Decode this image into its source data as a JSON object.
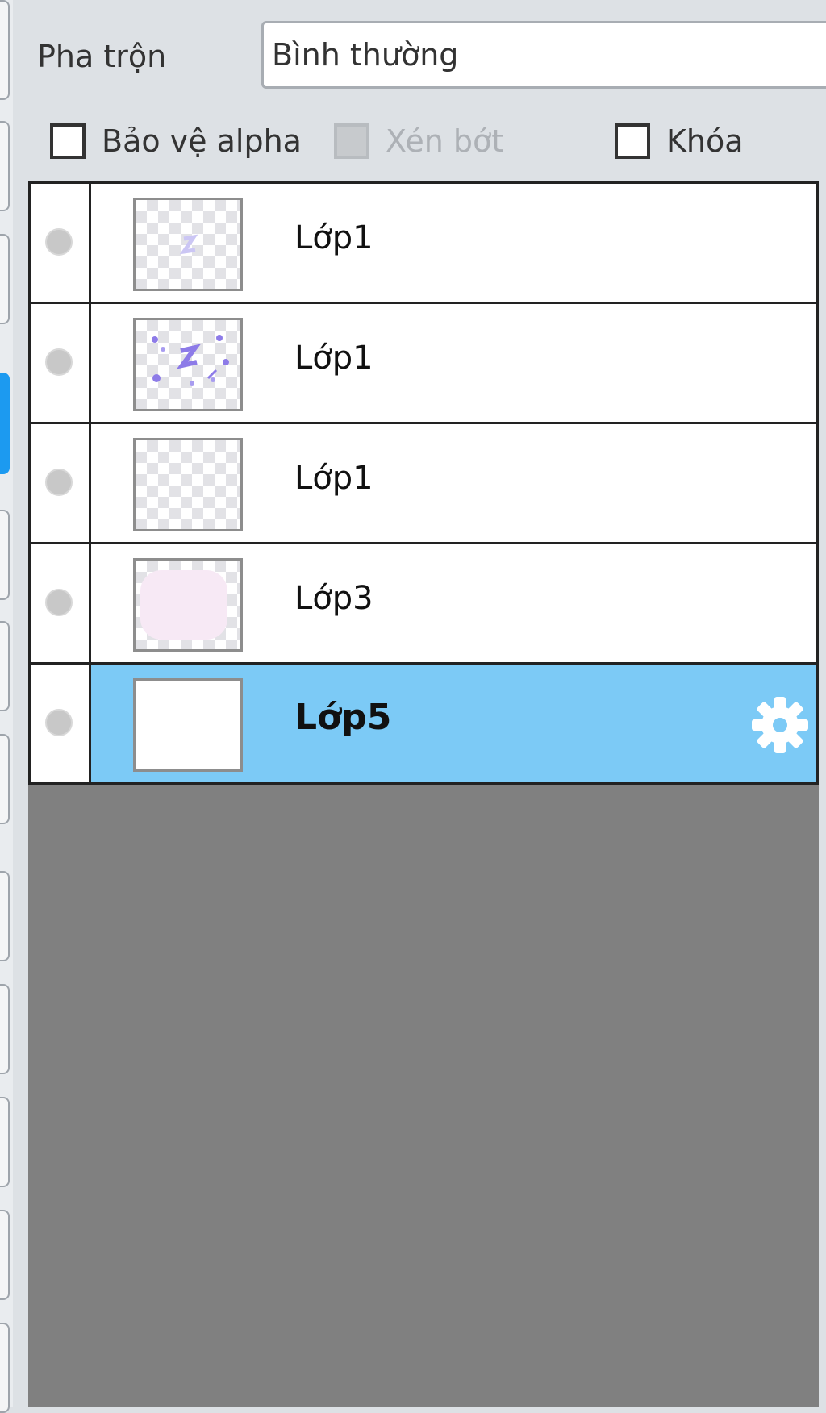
{
  "blend": {
    "label": "Pha trộn",
    "value": "Bình thường"
  },
  "options": [
    {
      "label": "Bảo vệ alpha",
      "checked": false,
      "disabled": false
    },
    {
      "label": "Xén bớt",
      "checked": false,
      "disabled": true
    },
    {
      "label": "Khóa",
      "checked": false,
      "disabled": false
    }
  ],
  "layers": [
    {
      "name": "Lớp1",
      "thumbnail": "transparent with faint purple mark",
      "selected": false
    },
    {
      "name": "Lớp1",
      "thumbnail": "transparent with purple sparkles",
      "selected": false
    },
    {
      "name": "Lớp1",
      "thumbnail": "transparent",
      "selected": false
    },
    {
      "name": "Lớp3",
      "thumbnail": "transparent with pink fill",
      "selected": false
    },
    {
      "name": "Lớp5",
      "thumbnail": "white",
      "selected": true,
      "icon": "gear-icon"
    }
  ],
  "colors": {
    "panel_background": "#dde1e5",
    "selected_row": "#7ccaf6",
    "list_empty_area": "#808080",
    "active_side_tab": "#1c9af0"
  }
}
